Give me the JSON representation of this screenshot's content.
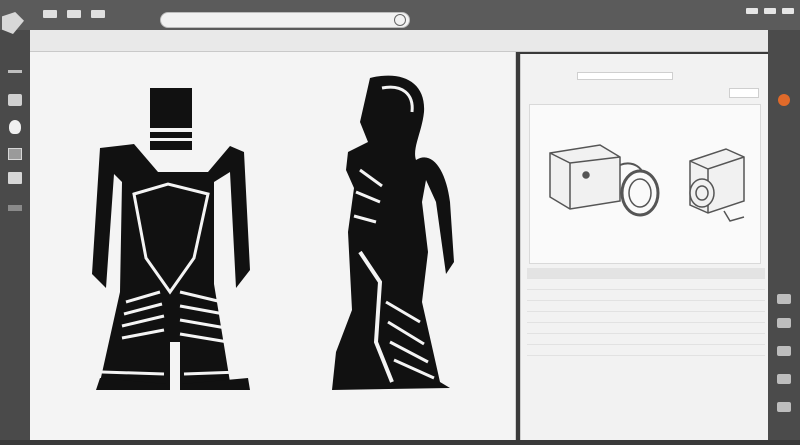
{
  "titlebar": {
    "menu": [
      "",
      " ",
      "",
      " ",
      "",
      "",
      ""
    ],
    "omnibox_placeholder": ""
  },
  "toolbar": {
    "buttons": [
      "",
      "",
      "",
      "",
      "",
      "",
      "",
      ""
    ],
    "sub_labels": [
      "",
      "",
      "",
      ""
    ]
  },
  "panel": {
    "header_label": "",
    "field_label": "",
    "dropdown_label": "",
    "table_header": [
      "",
      "",
      "",
      ""
    ],
    "rows": [
      [
        "",
        "",
        "",
        ""
      ],
      [
        "",
        "",
        "",
        ""
      ],
      [
        "",
        "",
        "",
        ""
      ],
      [
        "",
        "",
        "",
        ""
      ],
      [
        "",
        "",
        "",
        ""
      ],
      [
        "",
        "",
        "",
        ""
      ],
      [
        "",
        "",
        "",
        ""
      ]
    ],
    "footer": [
      "",
      ""
    ]
  },
  "colors": {
    "accent": "#e06a2a",
    "chrome": "#5b5b5b",
    "canvas": "#f4f4f4"
  },
  "icons": {
    "refresh": "refresh-icon",
    "logo": "app-logo-icon"
  }
}
